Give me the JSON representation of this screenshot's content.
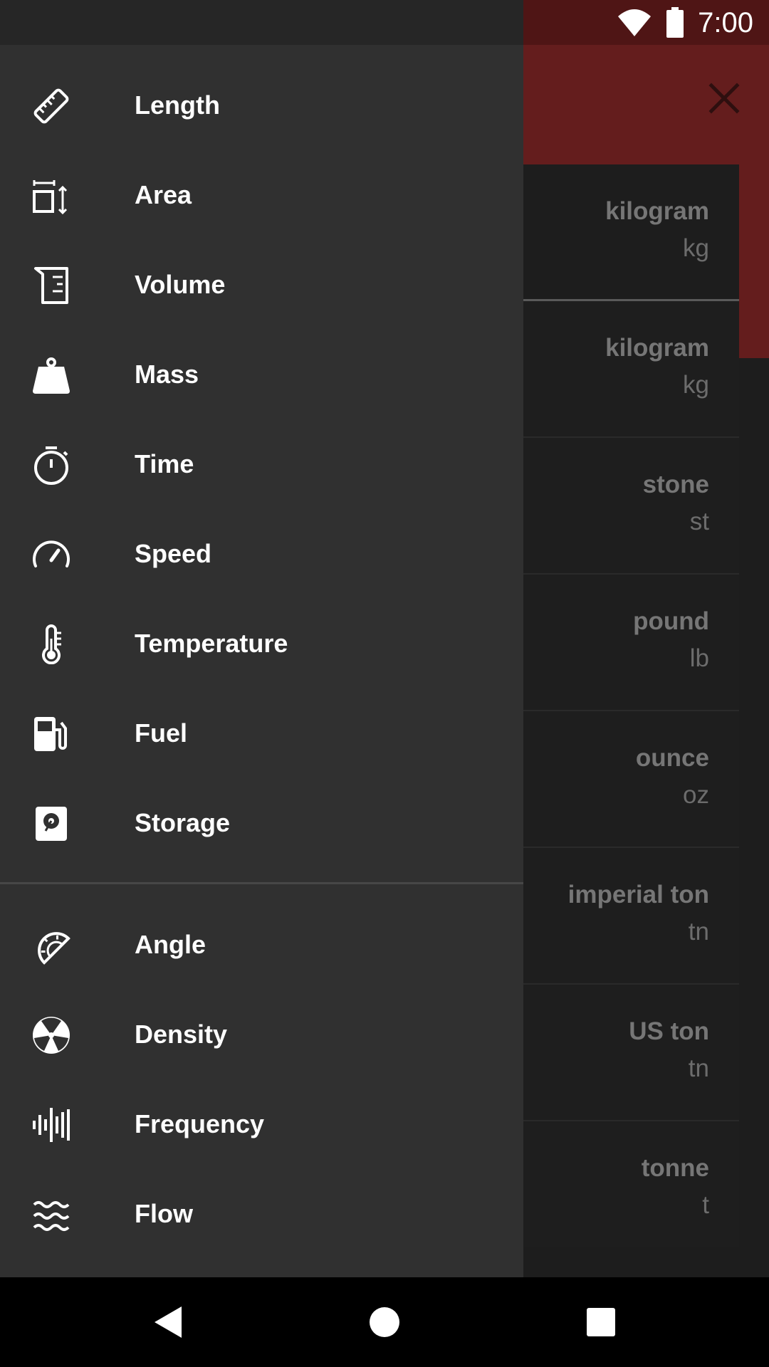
{
  "status_bar": {
    "time": "7:00",
    "icons": [
      "wifi-icon",
      "battery-icon"
    ]
  },
  "header": {
    "close_icon": "close-icon"
  },
  "units": [
    {
      "name": "kilogram",
      "abbr": "kg"
    },
    {
      "name": "kilogram",
      "abbr": "kg"
    },
    {
      "name": "stone",
      "abbr": "st"
    },
    {
      "name": "pound",
      "abbr": "lb"
    },
    {
      "name": "ounce",
      "abbr": "oz"
    },
    {
      "name": "imperial ton",
      "abbr": "tn"
    },
    {
      "name": "US ton",
      "abbr": "tn"
    },
    {
      "name": "tonne",
      "abbr": "t"
    }
  ],
  "drawer": {
    "primary_items": [
      {
        "label": "Length",
        "icon": "ruler-icon"
      },
      {
        "label": "Area",
        "icon": "area-icon"
      },
      {
        "label": "Volume",
        "icon": "beaker-icon"
      },
      {
        "label": "Mass",
        "icon": "weight-icon"
      },
      {
        "label": "Time",
        "icon": "stopwatch-icon"
      },
      {
        "label": "Speed",
        "icon": "speedometer-icon"
      },
      {
        "label": "Temperature",
        "icon": "thermometer-icon"
      },
      {
        "label": "Fuel",
        "icon": "fuel-pump-icon"
      },
      {
        "label": "Storage",
        "icon": "hard-drive-icon"
      }
    ],
    "secondary_items": [
      {
        "label": "Angle",
        "icon": "protractor-icon"
      },
      {
        "label": "Density",
        "icon": "density-icon"
      },
      {
        "label": "Frequency",
        "icon": "waveform-icon"
      },
      {
        "label": "Flow",
        "icon": "waves-icon"
      }
    ]
  },
  "colors": {
    "header": "#641d1d",
    "drawer_bg": "#303030",
    "status_bar": "#4f1515"
  },
  "navigation_bar": {
    "icons": [
      "back-icon",
      "home-icon",
      "recents-icon"
    ]
  }
}
